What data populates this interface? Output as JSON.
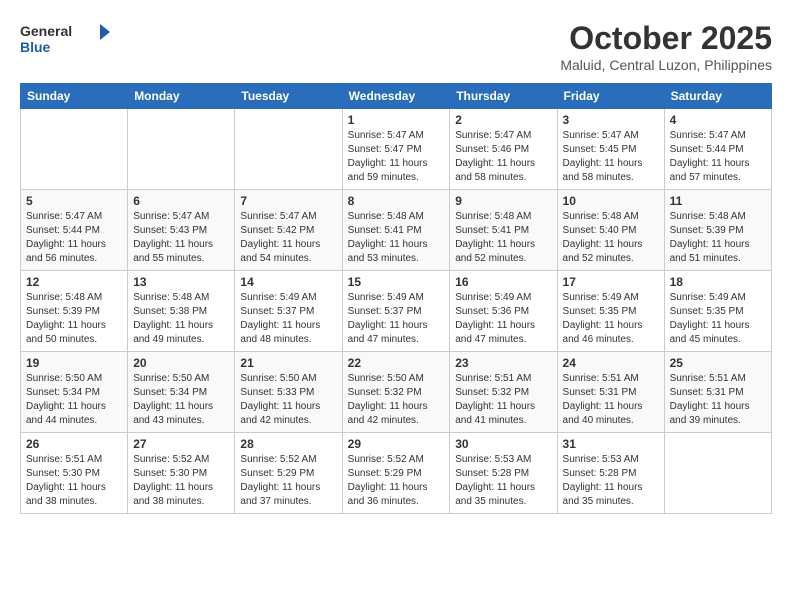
{
  "logo": {
    "line1": "General",
    "line2": "Blue"
  },
  "title": "October 2025",
  "location": "Maluid, Central Luzon, Philippines",
  "weekdays": [
    "Sunday",
    "Monday",
    "Tuesday",
    "Wednesday",
    "Thursday",
    "Friday",
    "Saturday"
  ],
  "weeks": [
    [
      {
        "day": "",
        "info": ""
      },
      {
        "day": "",
        "info": ""
      },
      {
        "day": "",
        "info": ""
      },
      {
        "day": "1",
        "info": "Sunrise: 5:47 AM\nSunset: 5:47 PM\nDaylight: 11 hours\nand 59 minutes."
      },
      {
        "day": "2",
        "info": "Sunrise: 5:47 AM\nSunset: 5:46 PM\nDaylight: 11 hours\nand 58 minutes."
      },
      {
        "day": "3",
        "info": "Sunrise: 5:47 AM\nSunset: 5:45 PM\nDaylight: 11 hours\nand 58 minutes."
      },
      {
        "day": "4",
        "info": "Sunrise: 5:47 AM\nSunset: 5:44 PM\nDaylight: 11 hours\nand 57 minutes."
      }
    ],
    [
      {
        "day": "5",
        "info": "Sunrise: 5:47 AM\nSunset: 5:44 PM\nDaylight: 11 hours\nand 56 minutes."
      },
      {
        "day": "6",
        "info": "Sunrise: 5:47 AM\nSunset: 5:43 PM\nDaylight: 11 hours\nand 55 minutes."
      },
      {
        "day": "7",
        "info": "Sunrise: 5:47 AM\nSunset: 5:42 PM\nDaylight: 11 hours\nand 54 minutes."
      },
      {
        "day": "8",
        "info": "Sunrise: 5:48 AM\nSunset: 5:41 PM\nDaylight: 11 hours\nand 53 minutes."
      },
      {
        "day": "9",
        "info": "Sunrise: 5:48 AM\nSunset: 5:41 PM\nDaylight: 11 hours\nand 52 minutes."
      },
      {
        "day": "10",
        "info": "Sunrise: 5:48 AM\nSunset: 5:40 PM\nDaylight: 11 hours\nand 52 minutes."
      },
      {
        "day": "11",
        "info": "Sunrise: 5:48 AM\nSunset: 5:39 PM\nDaylight: 11 hours\nand 51 minutes."
      }
    ],
    [
      {
        "day": "12",
        "info": "Sunrise: 5:48 AM\nSunset: 5:39 PM\nDaylight: 11 hours\nand 50 minutes."
      },
      {
        "day": "13",
        "info": "Sunrise: 5:48 AM\nSunset: 5:38 PM\nDaylight: 11 hours\nand 49 minutes."
      },
      {
        "day": "14",
        "info": "Sunrise: 5:49 AM\nSunset: 5:37 PM\nDaylight: 11 hours\nand 48 minutes."
      },
      {
        "day": "15",
        "info": "Sunrise: 5:49 AM\nSunset: 5:37 PM\nDaylight: 11 hours\nand 47 minutes."
      },
      {
        "day": "16",
        "info": "Sunrise: 5:49 AM\nSunset: 5:36 PM\nDaylight: 11 hours\nand 47 minutes."
      },
      {
        "day": "17",
        "info": "Sunrise: 5:49 AM\nSunset: 5:35 PM\nDaylight: 11 hours\nand 46 minutes."
      },
      {
        "day": "18",
        "info": "Sunrise: 5:49 AM\nSunset: 5:35 PM\nDaylight: 11 hours\nand 45 minutes."
      }
    ],
    [
      {
        "day": "19",
        "info": "Sunrise: 5:50 AM\nSunset: 5:34 PM\nDaylight: 11 hours\nand 44 minutes."
      },
      {
        "day": "20",
        "info": "Sunrise: 5:50 AM\nSunset: 5:34 PM\nDaylight: 11 hours\nand 43 minutes."
      },
      {
        "day": "21",
        "info": "Sunrise: 5:50 AM\nSunset: 5:33 PM\nDaylight: 11 hours\nand 42 minutes."
      },
      {
        "day": "22",
        "info": "Sunrise: 5:50 AM\nSunset: 5:32 PM\nDaylight: 11 hours\nand 42 minutes."
      },
      {
        "day": "23",
        "info": "Sunrise: 5:51 AM\nSunset: 5:32 PM\nDaylight: 11 hours\nand 41 minutes."
      },
      {
        "day": "24",
        "info": "Sunrise: 5:51 AM\nSunset: 5:31 PM\nDaylight: 11 hours\nand 40 minutes."
      },
      {
        "day": "25",
        "info": "Sunrise: 5:51 AM\nSunset: 5:31 PM\nDaylight: 11 hours\nand 39 minutes."
      }
    ],
    [
      {
        "day": "26",
        "info": "Sunrise: 5:51 AM\nSunset: 5:30 PM\nDaylight: 11 hours\nand 38 minutes."
      },
      {
        "day": "27",
        "info": "Sunrise: 5:52 AM\nSunset: 5:30 PM\nDaylight: 11 hours\nand 38 minutes."
      },
      {
        "day": "28",
        "info": "Sunrise: 5:52 AM\nSunset: 5:29 PM\nDaylight: 11 hours\nand 37 minutes."
      },
      {
        "day": "29",
        "info": "Sunrise: 5:52 AM\nSunset: 5:29 PM\nDaylight: 11 hours\nand 36 minutes."
      },
      {
        "day": "30",
        "info": "Sunrise: 5:53 AM\nSunset: 5:28 PM\nDaylight: 11 hours\nand 35 minutes."
      },
      {
        "day": "31",
        "info": "Sunrise: 5:53 AM\nSunset: 5:28 PM\nDaylight: 11 hours\nand 35 minutes."
      },
      {
        "day": "",
        "info": ""
      }
    ]
  ]
}
